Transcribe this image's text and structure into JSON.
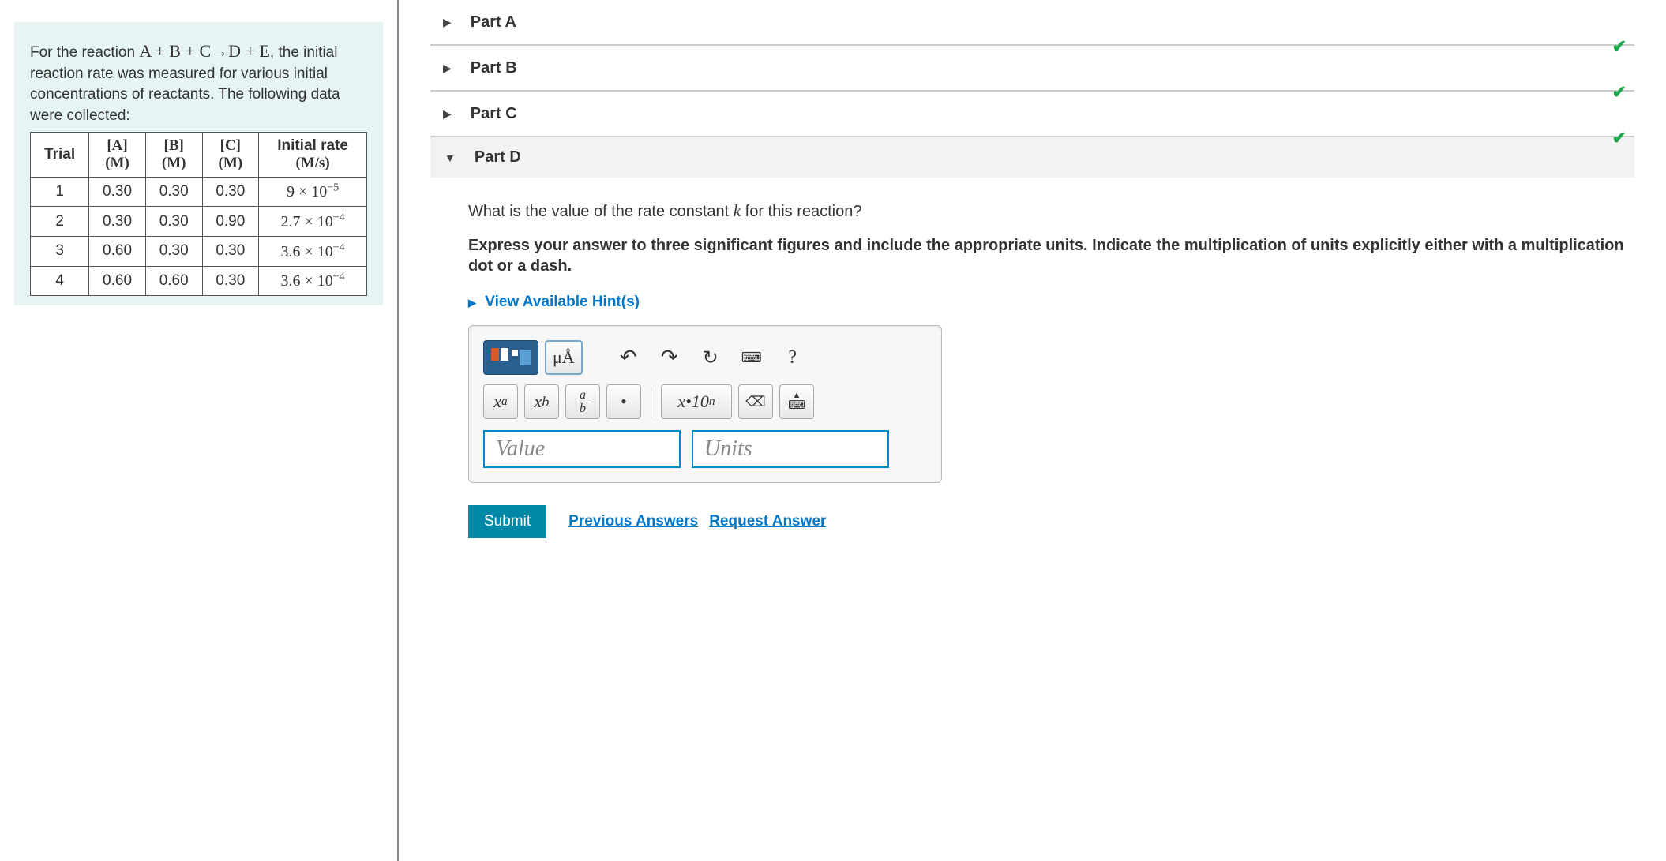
{
  "problem": {
    "intro_pre": "For the reaction ",
    "equation": "A + B + C→D + E",
    "intro_post": ", the initial reaction rate was measured for various initial concentrations of reactants. The following data were collected:"
  },
  "table": {
    "headers": {
      "trial": "Trial",
      "a_label": "[A]",
      "a_unit": "(M)",
      "b_label": "[B]",
      "b_unit": "(M)",
      "c_label": "[C]",
      "c_unit": "(M)",
      "rate_label": "Initial rate",
      "rate_unit": "(M/s)"
    },
    "rows": [
      {
        "trial": "1",
        "a": "0.30",
        "b": "0.30",
        "c": "0.30",
        "rate_coef": "9",
        "rate_exp": "−5"
      },
      {
        "trial": "2",
        "a": "0.30",
        "b": "0.30",
        "c": "0.90",
        "rate_coef": "2.7",
        "rate_exp": "−4"
      },
      {
        "trial": "3",
        "a": "0.60",
        "b": "0.30",
        "c": "0.30",
        "rate_coef": "3.6",
        "rate_exp": "−4"
      },
      {
        "trial": "4",
        "a": "0.60",
        "b": "0.60",
        "c": "0.30",
        "rate_coef": "3.6",
        "rate_exp": "−4"
      }
    ]
  },
  "parts": {
    "a": "Part A",
    "b": "Part B",
    "c": "Part C",
    "d": "Part D"
  },
  "partD": {
    "question_pre": "What is the value of the rate constant ",
    "question_k": "k",
    "question_post": " for this reaction?",
    "instruction": "Express your answer to three significant figures and include the appropriate units. Indicate the multiplication of units explicitly either with a multiplication dot or a dash.",
    "hint": "View Available Hint(s)",
    "value_ph": "Value",
    "units_ph": "Units",
    "submit": "Submit",
    "prev": "Previous Answers",
    "req": "Request Answer"
  },
  "toolbar": {
    "units_sym": "μÅ",
    "help": "?",
    "xa": "x",
    "xa_sup": "a",
    "xb": "x",
    "xb_sub": "b",
    "frac_top": "a",
    "frac_bot": "b",
    "dot": "•",
    "sci": "x•10",
    "sci_exp": "n",
    "backspace": "⌫"
  }
}
